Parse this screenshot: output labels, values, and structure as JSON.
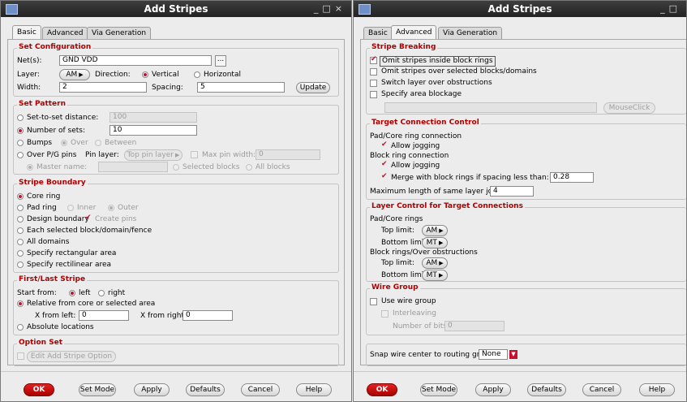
{
  "left": {
    "title": "Add Stripes",
    "tabs": [
      "Basic",
      "Advanced",
      "Via Generation"
    ],
    "set_config": {
      "title": "Set Configuration",
      "nets_label": "Net(s):",
      "nets_value": "GND VDD",
      "browse": "...",
      "layer_label": "Layer:",
      "layer_value": "AM",
      "direction_label": "Direction:",
      "vertical": "Vertical",
      "horizontal": "Horizontal",
      "width_label": "Width:",
      "width_value": "2",
      "spacing_label": "Spacing:",
      "spacing_value": "5",
      "update": "Update"
    },
    "set_pattern": {
      "title": "Set Pattern",
      "set_to_set": "Set-to-set distance:",
      "set_to_set_value": "100",
      "num_sets": "Number of sets:",
      "num_sets_value": "10",
      "bumps": "Bumps",
      "over": "Over",
      "between": "Between",
      "over_pg": "Over P/G pins",
      "pin_layer_label": "Pin layer:",
      "pin_layer_value": "Top pin layer",
      "max_pin_width": "Max pin width:",
      "max_pin_width_value": "0",
      "master_name": "Master name:",
      "selected_blocks": "Selected blocks",
      "all_blocks": "All blocks"
    },
    "boundary": {
      "title": "Stripe Boundary",
      "core_ring": "Core ring",
      "pad_ring": "Pad ring",
      "inner": "Inner",
      "outer": "Outer",
      "design_boundary": "Design boundary",
      "create_pins": "Create pins",
      "each_block": "Each selected block/domain/fence",
      "all_domains": "All domains",
      "rect_area": "Specify rectangular area",
      "rectilinear_area": "Specify rectilinear area"
    },
    "first_last": {
      "title": "First/Last Stripe",
      "start_from": "Start from:",
      "left": "left",
      "right": "right",
      "relative": "Relative from core or selected area",
      "x_from_left": "X from left:",
      "x_from_left_value": "0",
      "x_from_right": "X from right:",
      "x_from_right_value": "0",
      "absolute": "Absolute locations"
    },
    "option_set": {
      "title": "Option Set",
      "edit_btn": "Edit Add Stripe Option"
    },
    "footer": [
      "OK",
      "Set Mode",
      "Apply",
      "Defaults",
      "Cancel",
      "Help"
    ]
  },
  "right": {
    "title": "Add Stripes",
    "tabs": [
      "Basic",
      "Advanced",
      "Via Generation"
    ],
    "breaking": {
      "title": "Stripe Breaking",
      "omit_rings": "Omit stripes inside block rings",
      "omit_selected": "Omit stripes over selected blocks/domains",
      "switch_layer": "Switch layer over obstructions",
      "specify_blockage": "Specify area blockage",
      "mouse_click": "MouseClick"
    },
    "target": {
      "title": "Target Connection Control",
      "pad_core": "Pad/Core ring connection",
      "allow_jogging": "Allow jogging",
      "block_ring": "Block ring connection",
      "allow_jogging2": "Allow jogging",
      "merge": "Merge with block rings if spacing less than:",
      "merge_value": "0.28",
      "max_len": "Maximum length of same layer jog:",
      "max_len_value": "4"
    },
    "layer_ctrl": {
      "title": "Layer Control for Target Connections",
      "pad_core": "Pad/Core rings",
      "top_limit": "Top limit:",
      "top_value": "AM",
      "bottom_limit": "Bottom limit:",
      "bottom_value": "MT",
      "block_rings": "Block rings/Over obstructions",
      "top_limit2": "Top limit:",
      "top_value2": "AM",
      "bottom_limit2": "Bottom limit:",
      "bottom_value2": "MT"
    },
    "wire_group": {
      "title": "Wire Group",
      "use": "Use wire group",
      "interleaving": "Interleaving",
      "num_bits": "Number of bits:",
      "num_bits_value": "0"
    },
    "snap": {
      "label": "Snap wire center to routing grid:",
      "value": "None"
    },
    "footer": [
      "OK",
      "Set Mode",
      "Apply",
      "Defaults",
      "Cancel",
      "Help"
    ]
  }
}
